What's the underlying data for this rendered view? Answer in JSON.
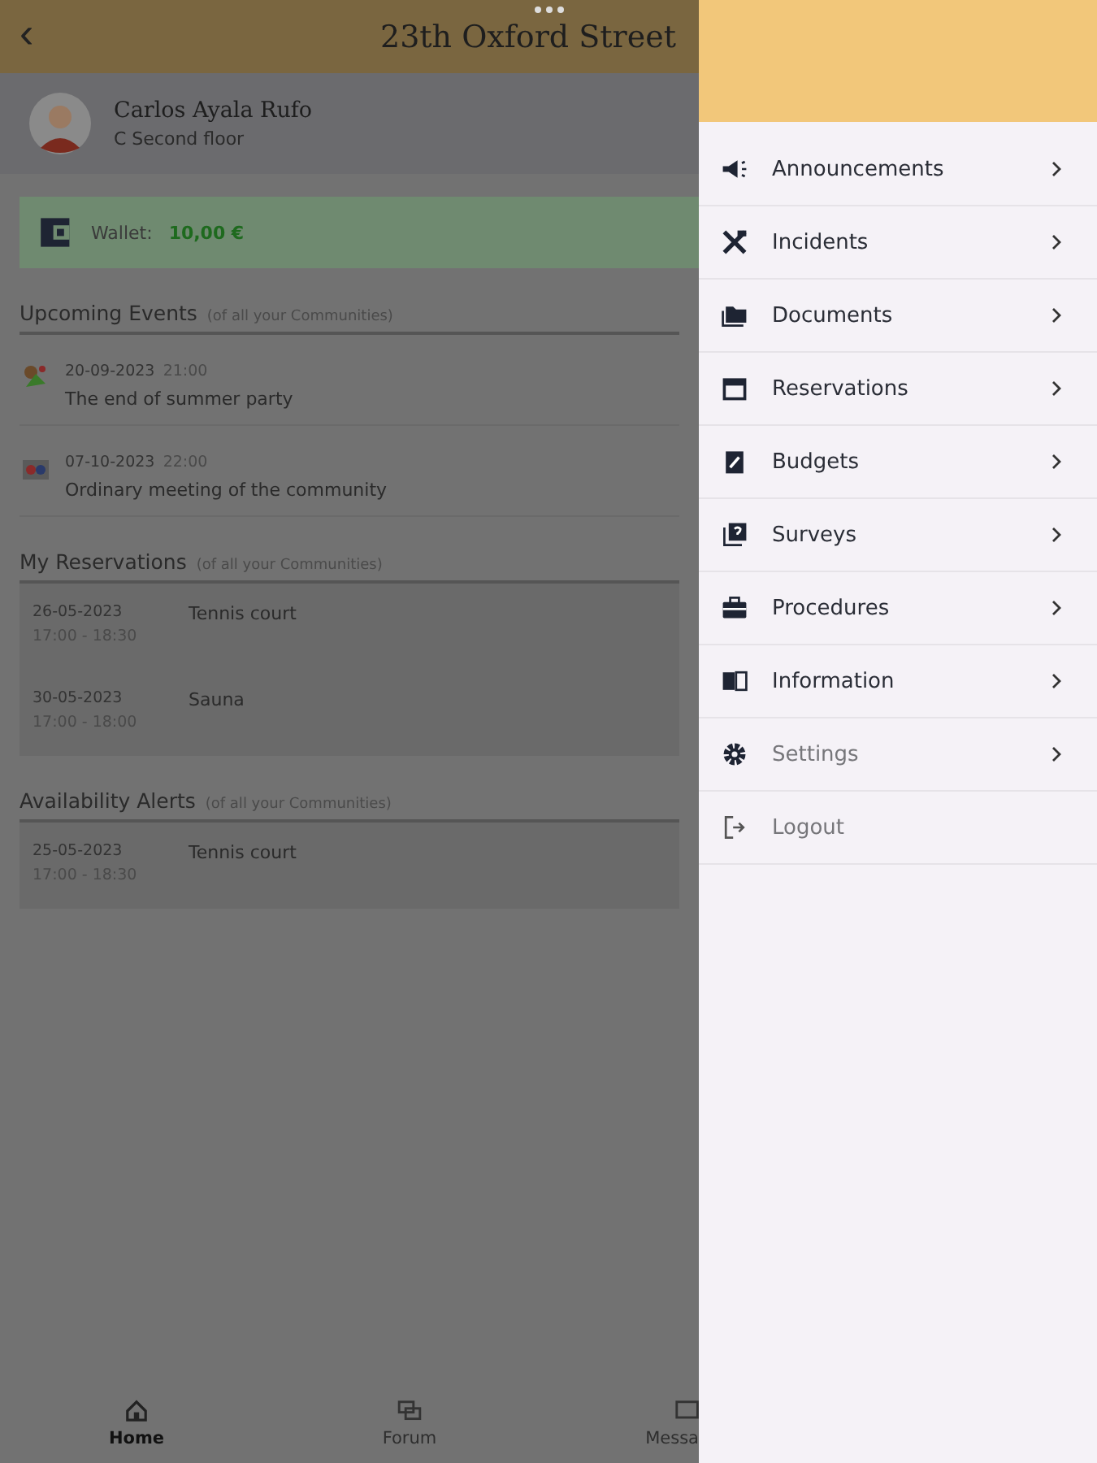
{
  "header": {
    "title": "23th Oxford Street",
    "back": "‹"
  },
  "profile": {
    "name": "Carlos Ayala Rufo",
    "unit": "C Second floor"
  },
  "wallet": {
    "label": "Wallet:",
    "amount": "10,00 €"
  },
  "events": {
    "title": "Upcoming Events",
    "note": "(of all your Communities)",
    "items": [
      {
        "date": "20-09-2023",
        "time": "21:00",
        "name": "The end of summer party"
      },
      {
        "date": "07-10-2023",
        "time": "22:00",
        "name": "Ordinary meeting of the community"
      }
    ]
  },
  "reservations": {
    "title": "My Reservations",
    "note": "(of all your Communities)",
    "items": [
      {
        "date": "26-05-2023",
        "time": "17:00 - 18:30",
        "name": "Tennis court"
      },
      {
        "date": "30-05-2023",
        "time": "17:00 - 18:00",
        "name": "Sauna"
      }
    ]
  },
  "alerts": {
    "title": "Availability Alerts",
    "note": "(of all your Communities)",
    "items": [
      {
        "date": "25-05-2023",
        "time": "17:00 - 18:30",
        "name": "Tennis court"
      }
    ]
  },
  "bottom_nav": [
    {
      "label": "Home",
      "selected": true
    },
    {
      "label": "Forum",
      "selected": false
    },
    {
      "label": "Messa",
      "selected": false
    }
  ],
  "menu": [
    {
      "label": "Announcements",
      "disabled": false,
      "chevron": true
    },
    {
      "label": "Incidents",
      "disabled": false,
      "chevron": true
    },
    {
      "label": "Documents",
      "disabled": false,
      "chevron": true
    },
    {
      "label": "Reservations",
      "disabled": false,
      "chevron": true
    },
    {
      "label": "Budgets",
      "disabled": false,
      "chevron": true
    },
    {
      "label": "Surveys",
      "disabled": false,
      "chevron": true
    },
    {
      "label": "Procedures",
      "disabled": false,
      "chevron": true
    },
    {
      "label": "Information",
      "disabled": false,
      "chevron": true
    },
    {
      "label": "Settings",
      "disabled": true,
      "chevron": true
    },
    {
      "label": "Logout",
      "disabled": true,
      "chevron": false
    }
  ]
}
